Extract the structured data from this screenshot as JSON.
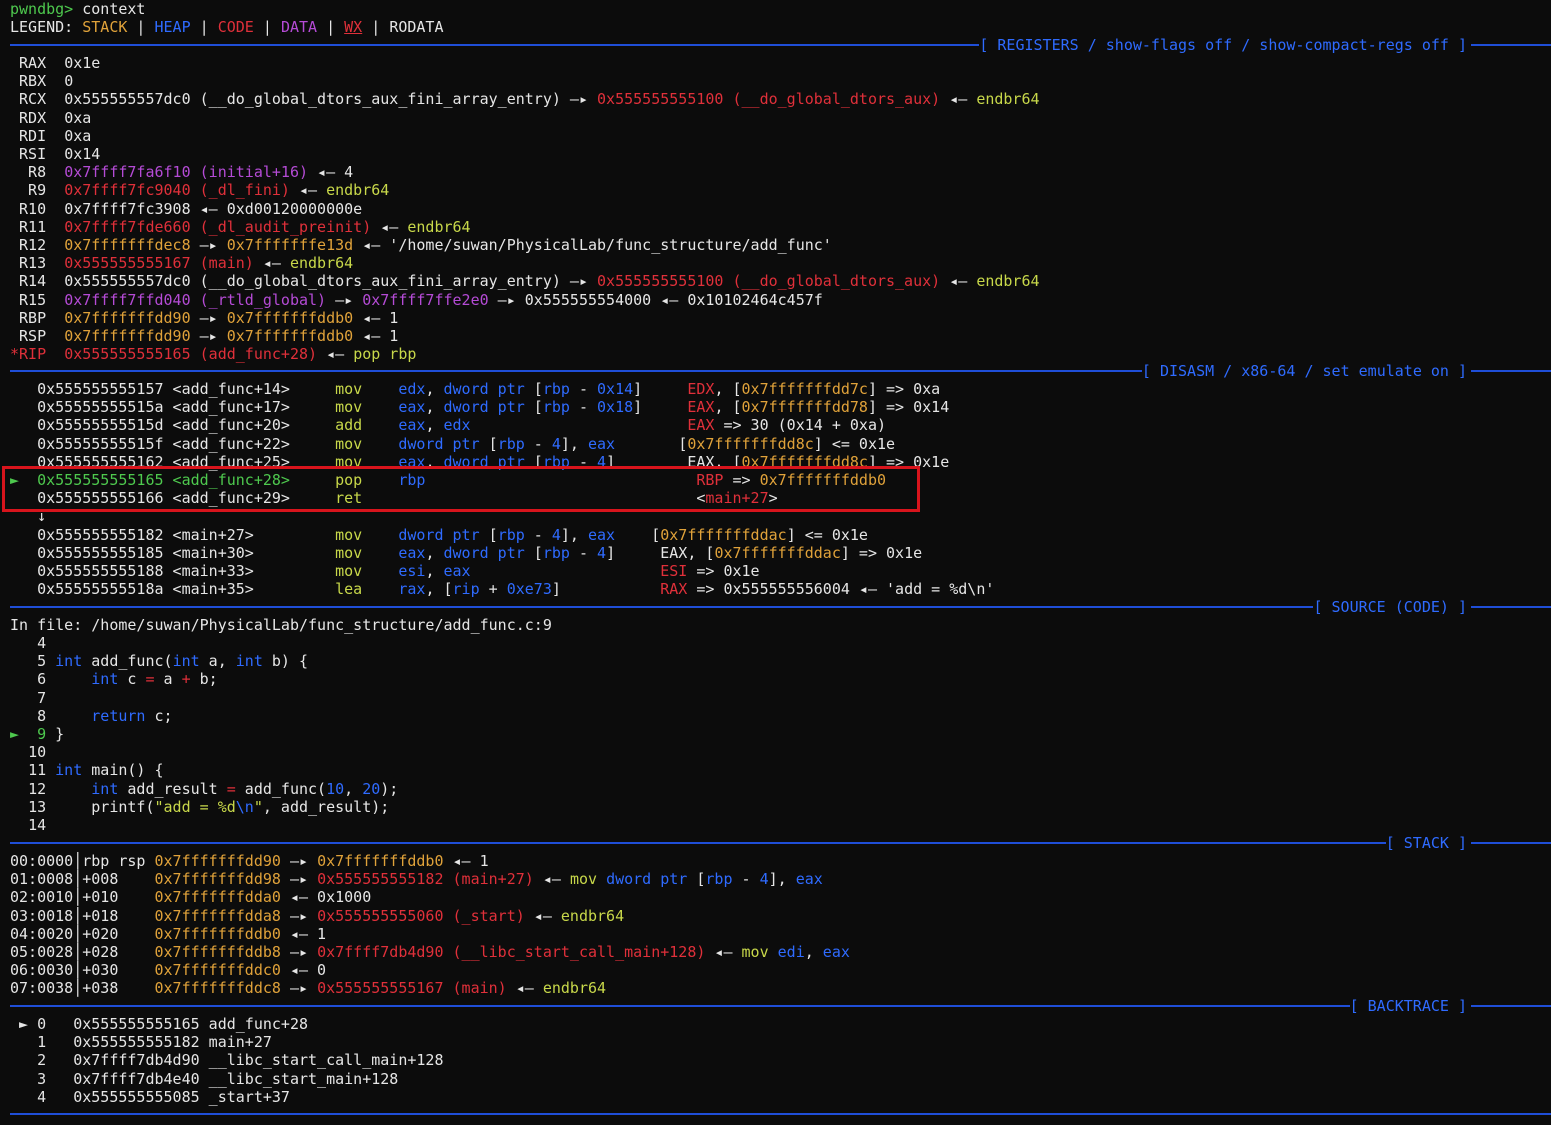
{
  "prompt": {
    "name": "pwndbg>",
    "command": " context"
  },
  "legend": {
    "label": "LEGEND: ",
    "stack": "STACK",
    "heap": "HEAP",
    "code": "CODE",
    "data": "DATA",
    "wx": "WX",
    "rodata": "RODATA",
    "sep": " | "
  },
  "sections": {
    "registers": "[ REGISTERS / show-flags off / show-compact-regs off ]",
    "disasm": "[ DISASM / x86-64 / set emulate on ]",
    "source": "[ SOURCE (CODE) ]",
    "stack": "[ STACK ]",
    "backtrace": "[ BACKTRACE ]"
  },
  "registers": [
    {
      "name": "RAX",
      "parts": [
        [
          "white",
          "0x1e"
        ]
      ]
    },
    {
      "name": "RBX",
      "parts": [
        [
          "white",
          "0"
        ]
      ]
    },
    {
      "name": "RCX",
      "parts": [
        [
          "white",
          "0x555555557dc0 (__do_global_dtors_aux_fini_array_entry) "
        ],
        [
          "white",
          "—▸ "
        ],
        [
          "red",
          "0x555555555100 (__do_global_dtors_aux)"
        ],
        [
          "white",
          " ◂— "
        ],
        [
          "lime",
          "endbr64"
        ]
      ]
    },
    {
      "name": "RDX",
      "parts": [
        [
          "white",
          "0xa"
        ]
      ]
    },
    {
      "name": "RDI",
      "parts": [
        [
          "white",
          "0xa"
        ]
      ]
    },
    {
      "name": "RSI",
      "parts": [
        [
          "white",
          "0x14"
        ]
      ]
    },
    {
      "name": "R8",
      "parts": [
        [
          "magenta",
          "0x7ffff7fa6f10 (initial+16)"
        ],
        [
          "white",
          " ◂— 4"
        ]
      ]
    },
    {
      "name": "R9",
      "parts": [
        [
          "red",
          "0x7ffff7fc9040 (_dl_fini)"
        ],
        [
          "white",
          " ◂— "
        ],
        [
          "lime",
          "endbr64"
        ]
      ]
    },
    {
      "name": "R10",
      "parts": [
        [
          "white",
          "0x7ffff7fc3908 ◂— 0xd00120000000e"
        ]
      ]
    },
    {
      "name": "R11",
      "parts": [
        [
          "red",
          "0x7ffff7fde660 (_dl_audit_preinit)"
        ],
        [
          "white",
          " ◂— "
        ],
        [
          "lime",
          "endbr64"
        ]
      ]
    },
    {
      "name": "R12",
      "parts": [
        [
          "orange",
          "0x7fffffffdec8"
        ],
        [
          "white",
          " —▸ "
        ],
        [
          "orange",
          "0x7fffffffe13d"
        ],
        [
          "white",
          " ◂— '/home/suwan/PhysicalLab/func_structure/add_func'"
        ]
      ]
    },
    {
      "name": "R13",
      "parts": [
        [
          "red",
          "0x555555555167 (main)"
        ],
        [
          "white",
          " ◂— "
        ],
        [
          "lime",
          "endbr64"
        ]
      ]
    },
    {
      "name": "R14",
      "parts": [
        [
          "white",
          "0x555555557dc0 (__do_global_dtors_aux_fini_array_entry) —▸ "
        ],
        [
          "red",
          "0x555555555100 (__do_global_dtors_aux)"
        ],
        [
          "white",
          " ◂— "
        ],
        [
          "lime",
          "endbr64"
        ]
      ]
    },
    {
      "name": "R15",
      "parts": [
        [
          "magenta",
          "0x7ffff7ffd040 (_rtld_global)"
        ],
        [
          "white",
          " —▸ "
        ],
        [
          "magenta",
          "0x7ffff7ffe2e0"
        ],
        [
          "white",
          " —▸ 0x555555554000 ◂— 0x10102464c457f"
        ]
      ]
    },
    {
      "name": "RBP",
      "parts": [
        [
          "orange",
          "0x7fffffffdd90"
        ],
        [
          "white",
          " —▸ "
        ],
        [
          "orange",
          "0x7fffffffddb0"
        ],
        [
          "white",
          " ◂— 1"
        ]
      ]
    },
    {
      "name": "RSP",
      "parts": [
        [
          "orange",
          "0x7fffffffdd90"
        ],
        [
          "white",
          " —▸ "
        ],
        [
          "orange",
          "0x7fffffffddb0"
        ],
        [
          "white",
          " ◂— 1"
        ]
      ]
    },
    {
      "name": "*RIP",
      "parts": [
        [
          "red",
          "0x555555555165 (add_func+28)"
        ],
        [
          "white",
          " ◂— "
        ],
        [
          "lime",
          "pop rbp"
        ]
      ]
    }
  ],
  "disasm": [
    {
      "marker": "  ",
      "addr": "0x555555555157 <add_func+14>",
      "op": "mov ",
      "args": [
        [
          "blue",
          "edx"
        ],
        [
          "white",
          ", "
        ],
        [
          "blue",
          "dword ptr"
        ],
        [
          "white",
          " ["
        ],
        [
          "blue",
          "rbp"
        ],
        [
          "white",
          " - "
        ],
        [
          "blue",
          "0x14"
        ],
        [
          "white",
          "]"
        ]
      ],
      "pad": "     ",
      "comment": [
        [
          "red",
          "EDX"
        ],
        [
          "white",
          ", ["
        ],
        [
          "orange",
          "0x7fffffffdd7c"
        ],
        [
          "white",
          "] => 0xa"
        ]
      ]
    },
    {
      "marker": "  ",
      "addr": "0x55555555515a <add_func+17>",
      "op": "mov ",
      "args": [
        [
          "blue",
          "eax"
        ],
        [
          "white",
          ", "
        ],
        [
          "blue",
          "dword ptr"
        ],
        [
          "white",
          " ["
        ],
        [
          "blue",
          "rbp"
        ],
        [
          "white",
          " - "
        ],
        [
          "blue",
          "0x18"
        ],
        [
          "white",
          "]"
        ]
      ],
      "pad": "     ",
      "comment": [
        [
          "red",
          "EAX"
        ],
        [
          "white",
          ", ["
        ],
        [
          "orange",
          "0x7fffffffdd78"
        ],
        [
          "white",
          "] => 0x14"
        ]
      ]
    },
    {
      "marker": "  ",
      "addr": "0x55555555515d <add_func+20>",
      "op": "add ",
      "args": [
        [
          "blue",
          "eax"
        ],
        [
          "white",
          ", "
        ],
        [
          "blue",
          "edx"
        ]
      ],
      "pad": "                        ",
      "comment": [
        [
          "red",
          "EAX"
        ],
        [
          "white",
          " => 30 (0x14 + 0xa)"
        ]
      ]
    },
    {
      "marker": "  ",
      "addr": "0x55555555515f <add_func+22>",
      "op": "mov ",
      "args": [
        [
          "blue",
          "dword ptr"
        ],
        [
          "white",
          " ["
        ],
        [
          "blue",
          "rbp"
        ],
        [
          "white",
          " - "
        ],
        [
          "blue",
          "4"
        ],
        [
          "white",
          "], "
        ],
        [
          "blue",
          "eax"
        ]
      ],
      "pad": "       ",
      "comment": [
        [
          "white",
          "["
        ],
        [
          "orange",
          "0x7fffffffdd8c"
        ],
        [
          "white",
          "] <= 0x1e"
        ]
      ]
    },
    {
      "marker": "  ",
      "addr": "0x555555555162 <add_func+25>",
      "op": "mov ",
      "args": [
        [
          "blue",
          "eax"
        ],
        [
          "white",
          ", "
        ],
        [
          "blue",
          "dword ptr"
        ],
        [
          "white",
          " ["
        ],
        [
          "blue",
          "rbp"
        ],
        [
          "white",
          " - "
        ],
        [
          "blue",
          "4"
        ],
        [
          "white",
          "]"
        ]
      ],
      "pad": "        ",
      "comment": [
        [
          "white",
          "EAX, ["
        ],
        [
          "orange",
          "0x7fffffffdd8c"
        ],
        [
          "white",
          "] => 0x1e"
        ]
      ]
    },
    {
      "marker": "► ",
      "addr": "0x555555555165 <add_func+28>",
      "current": true,
      "op": "pop ",
      "args": [
        [
          "blue",
          "rbp"
        ]
      ],
      "pad": "                              ",
      "comment": [
        [
          "red",
          "RBP"
        ],
        [
          "white",
          " => "
        ],
        [
          "orange",
          "0x7fffffffddb0"
        ]
      ]
    },
    {
      "marker": "  ",
      "addr": "0x555555555166 <add_func+29>",
      "op": "ret ",
      "args": [],
      "pad": "                                 ",
      "comment": [
        [
          "white",
          "<"
        ],
        [
          "red",
          "main+27"
        ],
        [
          "white",
          ">"
        ]
      ]
    },
    {
      "marker": "  ",
      "addr": "↓",
      "op": "",
      "args": [],
      "pad": "",
      "comment": []
    },
    {
      "marker": "  ",
      "addr": "0x555555555182 <main+27>    ",
      "op": "mov ",
      "args": [
        [
          "blue",
          "dword ptr"
        ],
        [
          "white",
          " ["
        ],
        [
          "blue",
          "rbp"
        ],
        [
          "white",
          " - "
        ],
        [
          "blue",
          "4"
        ],
        [
          "white",
          "], "
        ],
        [
          "blue",
          "eax"
        ]
      ],
      "pad": "    ",
      "comment": [
        [
          "white",
          "["
        ],
        [
          "orange",
          "0x7fffffffddac"
        ],
        [
          "white",
          "] <= 0x1e"
        ]
      ]
    },
    {
      "marker": "  ",
      "addr": "0x555555555185 <main+30>    ",
      "op": "mov ",
      "args": [
        [
          "blue",
          "eax"
        ],
        [
          "white",
          ", "
        ],
        [
          "blue",
          "dword ptr"
        ],
        [
          "white",
          " ["
        ],
        [
          "blue",
          "rbp"
        ],
        [
          "white",
          " - "
        ],
        [
          "blue",
          "4"
        ],
        [
          "white",
          "]"
        ]
      ],
      "pad": "     ",
      "comment": [
        [
          "white",
          "EAX, ["
        ],
        [
          "orange",
          "0x7fffffffddac"
        ],
        [
          "white",
          "] => 0x1e"
        ]
      ]
    },
    {
      "marker": "  ",
      "addr": "0x555555555188 <main+33>    ",
      "op": "mov ",
      "args": [
        [
          "blue",
          "esi"
        ],
        [
          "white",
          ", "
        ],
        [
          "blue",
          "eax"
        ]
      ],
      "pad": "                     ",
      "comment": [
        [
          "red",
          "ESI"
        ],
        [
          "white",
          " => 0x1e"
        ]
      ]
    },
    {
      "marker": "  ",
      "addr": "0x55555555518a <main+35>    ",
      "op": "lea ",
      "args": [
        [
          "blue",
          "rax"
        ],
        [
          "white",
          ", ["
        ],
        [
          "blue",
          "rip"
        ],
        [
          "white",
          " + "
        ],
        [
          "blue",
          "0xe73"
        ],
        [
          "white",
          "]"
        ]
      ],
      "pad": "           ",
      "comment": [
        [
          "red",
          "RAX"
        ],
        [
          "white",
          " => 0x555555556004 ◂— 'add = %d\\n'"
        ]
      ]
    }
  ],
  "source": {
    "file_line": "In file: /home/suwan/PhysicalLab/func_structure/add_func.c:9",
    "lines": [
      {
        "marker": "  ",
        "num": " 4",
        "code": []
      },
      {
        "marker": "  ",
        "num": " 5",
        "code": [
          [
            "blue",
            "int"
          ],
          [
            "white",
            " add_func("
          ],
          [
            "blue",
            "int"
          ],
          [
            "white",
            " a, "
          ],
          [
            "blue",
            "int"
          ],
          [
            "white",
            " b) {"
          ]
        ]
      },
      {
        "marker": "  ",
        "num": " 6",
        "code": [
          [
            "white",
            "    "
          ],
          [
            "blue",
            "int"
          ],
          [
            "white",
            " c "
          ],
          [
            "red",
            "="
          ],
          [
            "white",
            " a "
          ],
          [
            "red",
            "+"
          ],
          [
            "white",
            " b;"
          ]
        ]
      },
      {
        "marker": "  ",
        "num": " 7",
        "code": []
      },
      {
        "marker": "  ",
        "num": " 8",
        "code": [
          [
            "white",
            "    "
          ],
          [
            "blue",
            "return"
          ],
          [
            "white",
            " c;"
          ]
        ]
      },
      {
        "marker": "► ",
        "num": " 9",
        "current": true,
        "code": [
          [
            "white",
            "}"
          ]
        ]
      },
      {
        "marker": "  ",
        "num": "10",
        "code": []
      },
      {
        "marker": "  ",
        "num": "11",
        "code": [
          [
            "blue",
            "int"
          ],
          [
            "white",
            " main() {"
          ]
        ]
      },
      {
        "marker": "  ",
        "num": "12",
        "code": [
          [
            "white",
            "    "
          ],
          [
            "blue",
            "int"
          ],
          [
            "white",
            " add_result "
          ],
          [
            "red",
            "="
          ],
          [
            "white",
            " add_func("
          ],
          [
            "blue",
            "10"
          ],
          [
            "white",
            ", "
          ],
          [
            "blue",
            "20"
          ],
          [
            "white",
            ");"
          ]
        ]
      },
      {
        "marker": "  ",
        "num": "13",
        "code": [
          [
            "white",
            "    printf("
          ],
          [
            "lime",
            "\"add = %d"
          ],
          [
            "blue",
            "\\n"
          ],
          [
            "lime",
            "\""
          ],
          [
            "white",
            ", add_result);"
          ]
        ]
      },
      {
        "marker": "  ",
        "num": "14",
        "code": []
      }
    ]
  },
  "stack": [
    {
      "idx": "00:0000",
      "off": "rbp rsp",
      "parts": [
        [
          "orange",
          "0x7fffffffdd90"
        ],
        [
          "white",
          " —▸ "
        ],
        [
          "orange",
          "0x7fffffffddb0"
        ],
        [
          "white",
          " ◂— 1"
        ]
      ]
    },
    {
      "idx": "01:0008",
      "off": "+008   ",
      "parts": [
        [
          "orange",
          "0x7fffffffdd98"
        ],
        [
          "white",
          " —▸ "
        ],
        [
          "red",
          "0x555555555182 (main+27)"
        ],
        [
          "white",
          " ◂— "
        ],
        [
          "lime",
          "mov"
        ],
        [
          "white",
          " "
        ],
        [
          "blue",
          "dword ptr"
        ],
        [
          "white",
          " ["
        ],
        [
          "blue",
          "rbp"
        ],
        [
          "white",
          " - "
        ],
        [
          "blue",
          "4"
        ],
        [
          "white",
          "], "
        ],
        [
          "blue",
          "eax"
        ]
      ]
    },
    {
      "idx": "02:0010",
      "off": "+010   ",
      "parts": [
        [
          "orange",
          "0x7fffffffdda0"
        ],
        [
          "white",
          " ◂— 0x1000"
        ]
      ]
    },
    {
      "idx": "03:0018",
      "off": "+018   ",
      "parts": [
        [
          "orange",
          "0x7fffffffdda8"
        ],
        [
          "white",
          " —▸ "
        ],
        [
          "red",
          "0x555555555060 (_start)"
        ],
        [
          "white",
          " ◂— "
        ],
        [
          "lime",
          "endbr64"
        ]
      ]
    },
    {
      "idx": "04:0020",
      "off": "+020   ",
      "parts": [
        [
          "orange",
          "0x7fffffffddb0"
        ],
        [
          "white",
          " ◂— 1"
        ]
      ]
    },
    {
      "idx": "05:0028",
      "off": "+028   ",
      "parts": [
        [
          "orange",
          "0x7fffffffddb8"
        ],
        [
          "white",
          " —▸ "
        ],
        [
          "red",
          "0x7ffff7db4d90 (__libc_start_call_main+128)"
        ],
        [
          "white",
          " ◂— "
        ],
        [
          "lime",
          "mov"
        ],
        [
          "white",
          " "
        ],
        [
          "blue",
          "edi"
        ],
        [
          "white",
          ", "
        ],
        [
          "blue",
          "eax"
        ]
      ]
    },
    {
      "idx": "06:0030",
      "off": "+030   ",
      "parts": [
        [
          "orange",
          "0x7fffffffddc0"
        ],
        [
          "white",
          " ◂— 0"
        ]
      ]
    },
    {
      "idx": "07:0038",
      "off": "+038   ",
      "parts": [
        [
          "orange",
          "0x7fffffffddc8"
        ],
        [
          "white",
          " —▸ "
        ],
        [
          "red",
          "0x555555555167 (main)"
        ],
        [
          "white",
          " ◂— "
        ],
        [
          "lime",
          "endbr64"
        ]
      ]
    }
  ],
  "backtrace": [
    {
      "marker": "► ",
      "frame": "0",
      "text": "   0x555555555165 add_func+28"
    },
    {
      "marker": "  ",
      "frame": "1",
      "text": "   0x555555555182 main+27"
    },
    {
      "marker": "  ",
      "frame": "2",
      "text": "   0x7ffff7db4d90 __libc_start_call_main+128"
    },
    {
      "marker": "  ",
      "frame": "3",
      "text": "   0x7ffff7db4e40 __libc_start_main+128"
    },
    {
      "marker": "  ",
      "frame": "4",
      "text": "   0x555555555085 _start+37"
    }
  ],
  "colors": {
    "green": "#4ec94e",
    "orange": "#e0a23a",
    "red": "#e0303a",
    "magenta": "#b54bd6",
    "blue": "#2f6bff",
    "lime": "#c8d84a",
    "background": "#0c0c0c",
    "highlight": "#d8141c"
  }
}
